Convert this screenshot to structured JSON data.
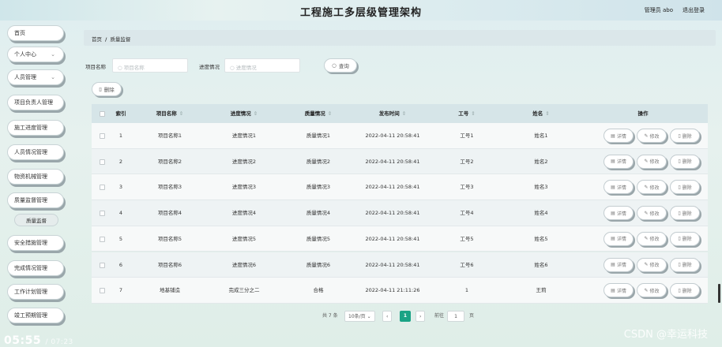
{
  "header": {
    "title": "工程施工多层级管理架构",
    "user": "管理员 abo",
    "logout": "退出登录"
  },
  "sidebar": {
    "items": [
      {
        "label": "首页",
        "chevron": false
      },
      {
        "label": "个人中心",
        "chevron": true
      },
      {
        "label": "人员管理",
        "chevron": true
      },
      {
        "label": "项目负责人管理",
        "chevron": false
      },
      {
        "label": "施工进度管理",
        "chevron": false
      },
      {
        "label": "人员情况管理",
        "chevron": false
      },
      {
        "label": "物资机械管理",
        "chevron": false
      },
      {
        "label": "质量监督管理",
        "chevron": false
      },
      {
        "label": "安全措施管理",
        "chevron": false
      },
      {
        "label": "完成情况管理",
        "chevron": false
      },
      {
        "label": "工作计划管理",
        "chevron": false
      },
      {
        "label": "竣工预期管理",
        "chevron": false
      }
    ],
    "subitem": "质量监督"
  },
  "breadcrumb": {
    "home": "首页",
    "sep": "/",
    "current": "质量监督"
  },
  "filters": {
    "name_label": "项目名称",
    "name_placeholder": "项目名称",
    "progress_label": "进度情况",
    "progress_placeholder": "进度情况",
    "search_label": "查询"
  },
  "toolbar": {
    "delete_label": "删除"
  },
  "table": {
    "headers": [
      "索引",
      "项目名称",
      "进度情况",
      "质量情况",
      "发布时间",
      "工号",
      "姓名",
      "操作"
    ],
    "rows": [
      [
        "1",
        "项目名称1",
        "进度情况1",
        "质量情况1",
        "2022-04-11 20:58:41",
        "工号1",
        "姓名1"
      ],
      [
        "2",
        "项目名称2",
        "进度情况2",
        "质量情况2",
        "2022-04-11 20:58:41",
        "工号2",
        "姓名2"
      ],
      [
        "3",
        "项目名称3",
        "进度情况3",
        "质量情况3",
        "2022-04-11 20:58:41",
        "工号3",
        "姓名3"
      ],
      [
        "4",
        "项目名称4",
        "进度情况4",
        "质量情况4",
        "2022-04-11 20:58:41",
        "工号4",
        "姓名4"
      ],
      [
        "5",
        "项目名称5",
        "进度情况5",
        "质量情况5",
        "2022-04-11 20:58:41",
        "工号5",
        "姓名5"
      ],
      [
        "6",
        "项目名称6",
        "进度情况6",
        "质量情况6",
        "2022-04-11 20:58:41",
        "工号6",
        "姓名6"
      ],
      [
        "7",
        "地基铺造",
        "完成三分之二",
        "合格",
        "2022-04-11 21:11:26",
        "1",
        "王莉"
      ]
    ],
    "actions": {
      "detail": "详情",
      "edit": "修改",
      "delete": "删除"
    }
  },
  "pager": {
    "total": "共 7 条",
    "page_size": "10条/页",
    "current": "1",
    "goto_prefix": "前往",
    "goto_value": "1",
    "goto_suffix": "页"
  },
  "overlay": {
    "clock": "05:55",
    "clock_total": "/ 07:23",
    "watermark": "CSDN @幸运科技"
  }
}
